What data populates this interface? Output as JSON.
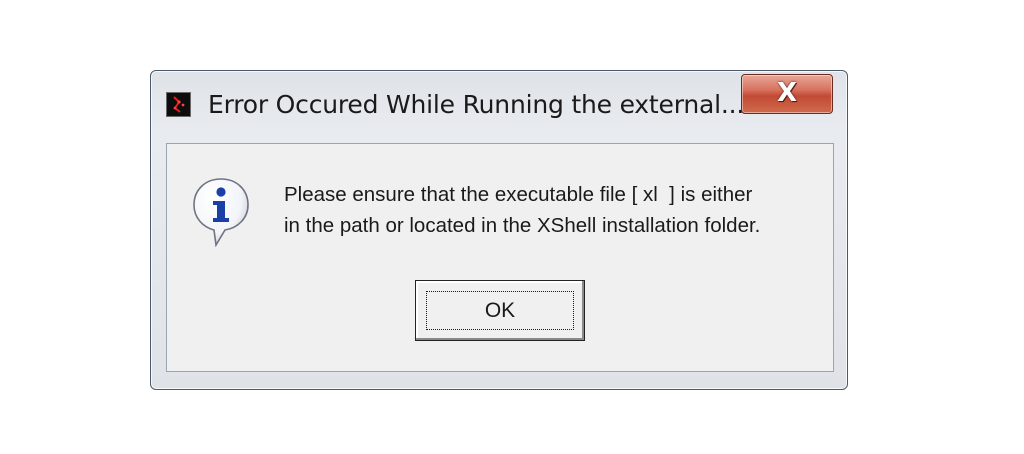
{
  "window": {
    "title": "Error Occured While Running the external...",
    "app_icon": "xshell-app-icon",
    "close_label": "X"
  },
  "dialog": {
    "icon": "information-icon",
    "message": "Please ensure that the executable file [ xl  ] is either\nin the path or located in the XShell installation folder.",
    "ok_label": "OK"
  },
  "colors": {
    "close_button": "#c9543c",
    "dialog_background": "#f0f0f0",
    "info_icon_blue": "#1a3fa6"
  }
}
